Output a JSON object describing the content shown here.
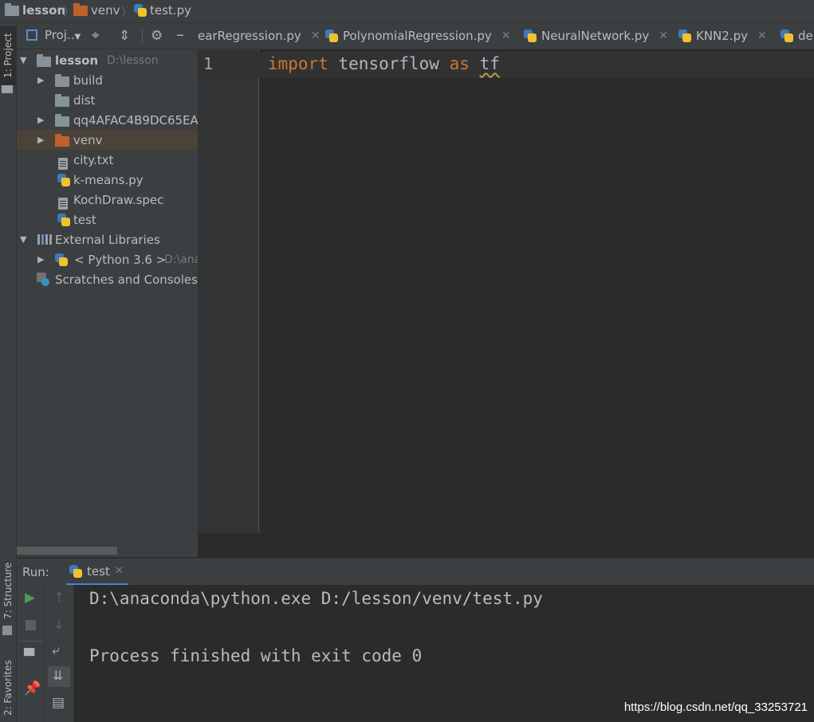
{
  "breadcrumb": {
    "items": [
      {
        "label": "lesson",
        "icon": "folder-icon"
      },
      {
        "label": "venv",
        "icon": "folder-icon"
      },
      {
        "label": "test.py",
        "icon": "python-file-icon"
      }
    ]
  },
  "left_strip": {
    "project_tab": "1: Project",
    "structure_tab": "7: Structure",
    "favorites_tab": "2: Favorites"
  },
  "project_panel": {
    "title": "Proj..",
    "tree": [
      {
        "label": "lesson",
        "detail": "D:\\lesson",
        "bold": true,
        "icon": "folder-icon",
        "expanded": true
      },
      {
        "label": "build",
        "icon": "folder-icon",
        "has_children": true
      },
      {
        "label": "dist",
        "icon": "folder-icon"
      },
      {
        "label": "qq4AFAC4B9DC65EA",
        "icon": "folder-icon",
        "has_children": true
      },
      {
        "label": "venv",
        "icon": "folder-icon",
        "has_children": true,
        "selected": true
      },
      {
        "label": "city.txt",
        "icon": "text-file-icon"
      },
      {
        "label": "k-means.py",
        "icon": "python-file-icon"
      },
      {
        "label": "KochDraw.spec",
        "icon": "text-file-icon"
      },
      {
        "label": "test",
        "icon": "python-file-icon"
      },
      {
        "label": "External Libraries",
        "icon": "library-icon",
        "expanded": true
      },
      {
        "label": "< Python 3.6 >",
        "detail": "D:\\ana",
        "icon": "python-icon",
        "has_children": true
      },
      {
        "label": "Scratches and Consoles",
        "icon": "console-icon"
      }
    ]
  },
  "tabs": [
    {
      "label": "earRegression.py"
    },
    {
      "label": "PolynomialRegression.py"
    },
    {
      "label": "NeuralNetwork.py"
    },
    {
      "label": "KNN2.py"
    },
    {
      "label": "de"
    }
  ],
  "editor": {
    "line_number": "1",
    "code": {
      "kw1": "import",
      "module": "tensorflow",
      "kw2": "as",
      "alias": "tf"
    }
  },
  "run_panel": {
    "label": "Run:",
    "tab": "test",
    "output": [
      "D:\\anaconda\\python.exe D:/lesson/venv/test.py",
      "Process finished with exit code 0"
    ]
  },
  "watermark": "https://blog.csdn.net/qq_33253721",
  "colors": {
    "keyword": "#cc7832",
    "identifier": "#a9b7c6",
    "run_green": "#499c54",
    "selected_row": "#4b4337"
  }
}
